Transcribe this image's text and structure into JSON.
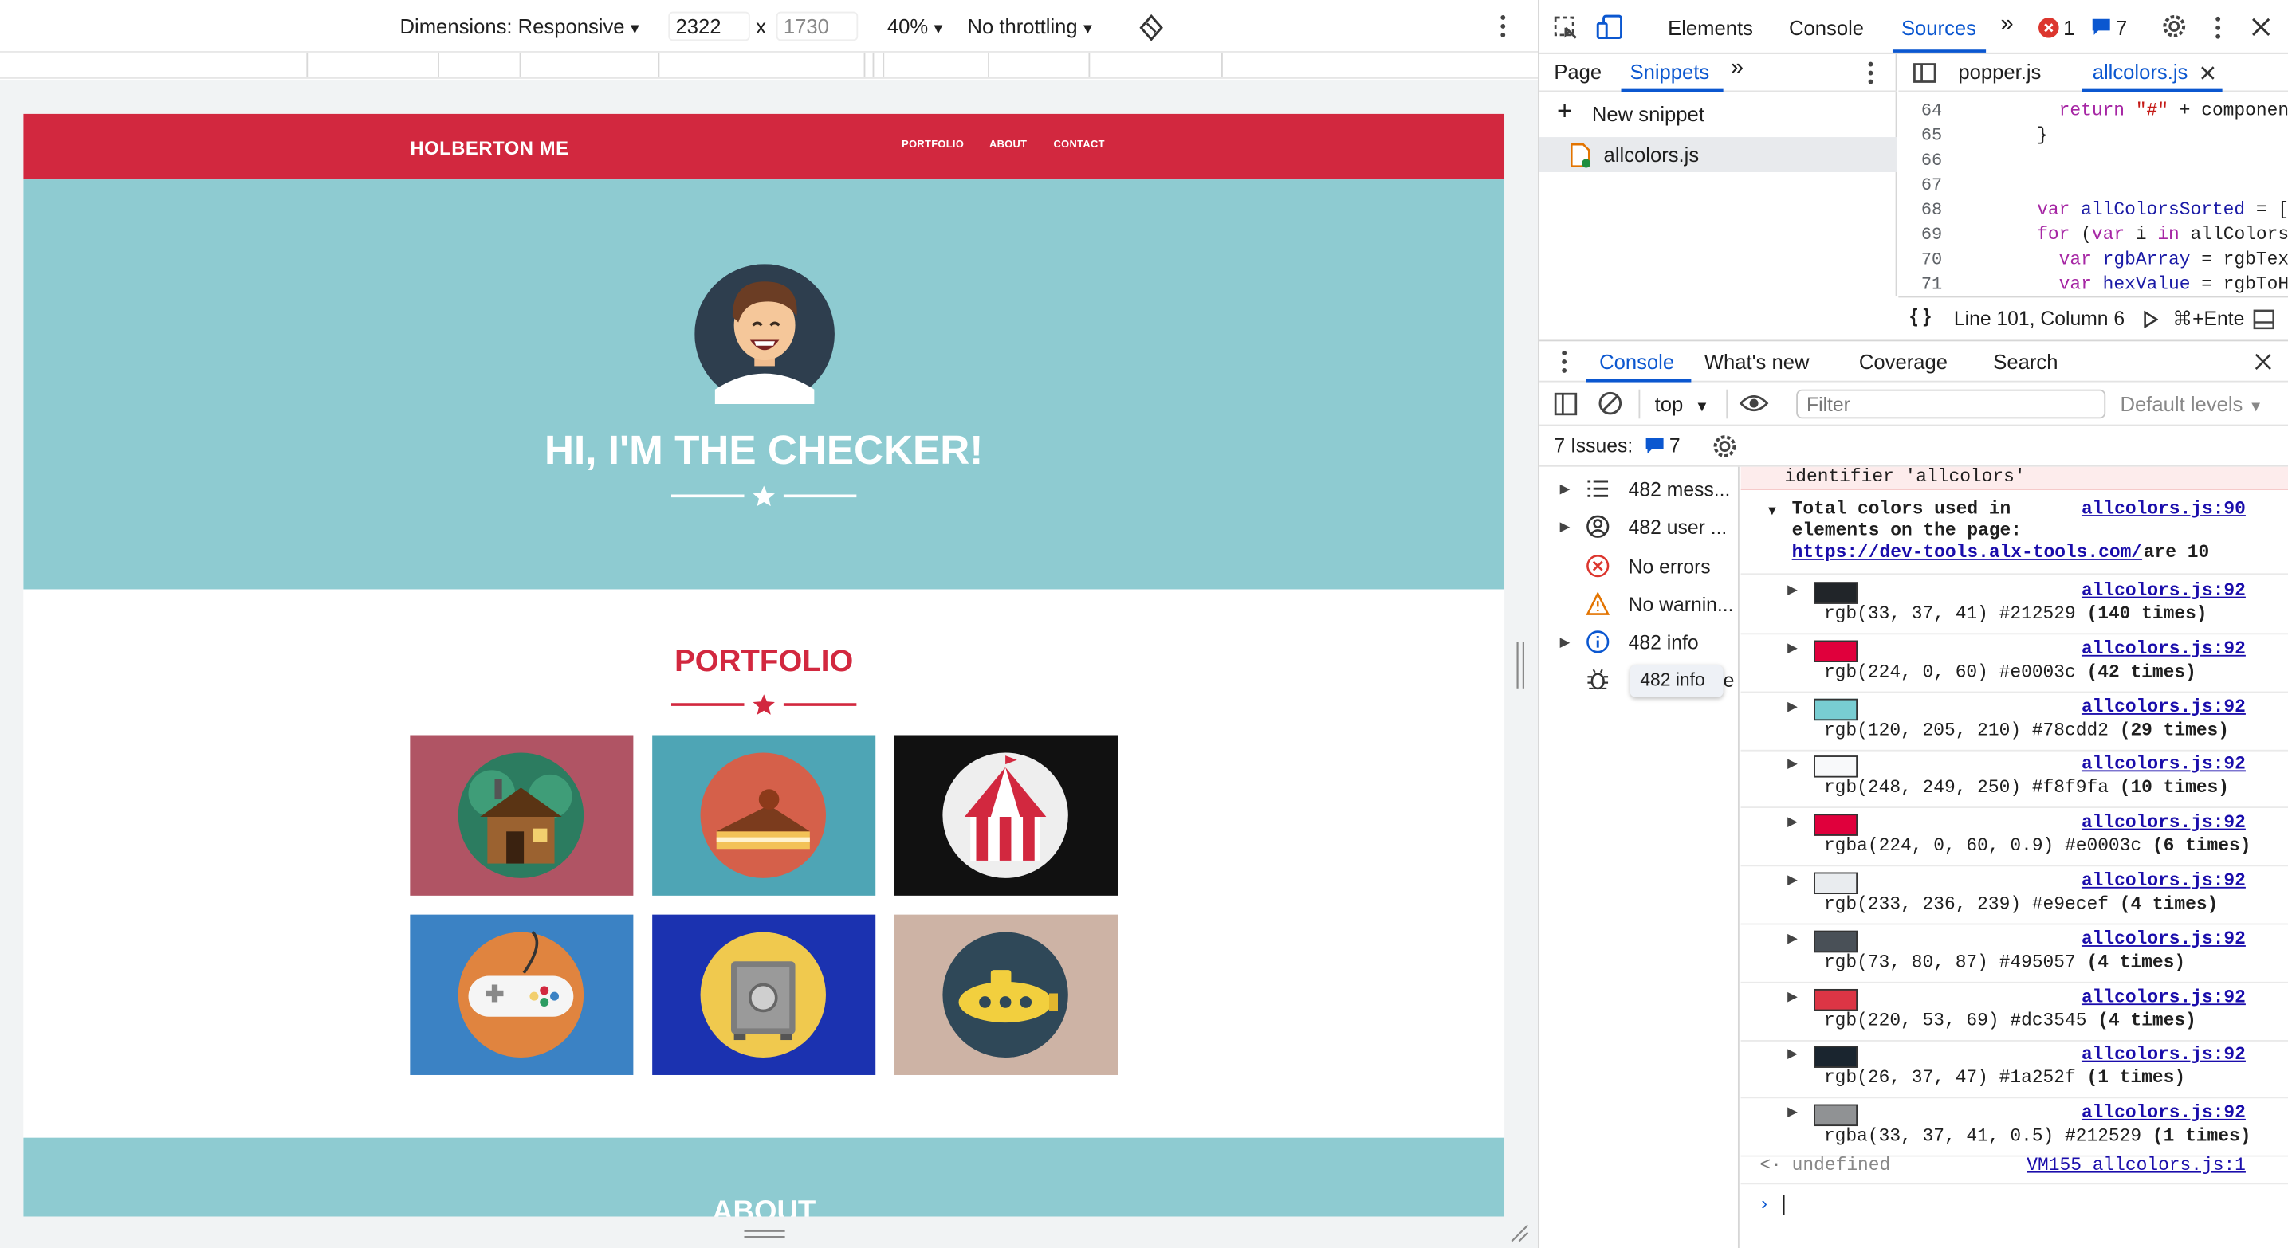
{
  "device_toolbar": {
    "dimensions_label": "Dimensions: Responsive",
    "width": "2322",
    "height": "1730",
    "times": "x",
    "zoom": "40%",
    "throttling": "No throttling"
  },
  "site": {
    "brand": "HOLBERTON ME",
    "nav": [
      "PORTFOLIO",
      "ABOUT",
      "CONTACT"
    ],
    "hero_title": "HI, I'M THE CHECKER!",
    "portfolio_title": "PORTFOLIO",
    "about_title": "ABOUT",
    "tiles": [
      {
        "name": "cabin",
        "bg": "#b05464"
      },
      {
        "name": "cake",
        "bg": "#4ea5b5"
      },
      {
        "name": "circus",
        "bg": "#111111"
      },
      {
        "name": "controller",
        "bg": "#3b82c4"
      },
      {
        "name": "safe",
        "bg": "#1b32b0"
      },
      {
        "name": "submarine",
        "bg": "#cdb3a5"
      }
    ],
    "colors": {
      "red": "#d2283f",
      "teal": "#8ecbd1"
    }
  },
  "devtools": {
    "tabs": [
      "Elements",
      "Console",
      "Sources"
    ],
    "active_tab": "Sources",
    "error_count": "1",
    "issue_count": "7",
    "navigator": {
      "tabs": [
        "Page",
        "Snippets"
      ],
      "active": "Snippets",
      "new_snippet": "New snippet",
      "file": "allcolors.js"
    },
    "editor": {
      "open_files": [
        "popper.js",
        "allcolors.js"
      ],
      "lines": [
        {
          "n": "64",
          "code": "    return \"#\" + componentTo"
        },
        {
          "n": "65",
          "code": "  }"
        },
        {
          "n": "66",
          "code": ""
        },
        {
          "n": "67",
          "code": ""
        },
        {
          "n": "68",
          "code": "  var allColorsSorted = [];"
        },
        {
          "n": "69",
          "code": "  for (var i in allColors) {"
        },
        {
          "n": "70",
          "code": "    var rgbArray = rgbTextTo"
        },
        {
          "n": "71",
          "code": "    var hexValue = rgbToHex("
        }
      ],
      "status": "Line 101, Column 6",
      "run_hint": "⌘+Ente"
    },
    "drawer_tabs": [
      "Console",
      "What's new",
      "Coverage",
      "Search"
    ],
    "drawer_active": "Console",
    "console_toolbar": {
      "context": "top",
      "filter_placeholder": "Filter",
      "levels": "Default levels"
    },
    "issues_label": "7 Issues:",
    "issues_count": "7",
    "sidebar": [
      {
        "label": "482 mess...",
        "icon": "list-icon"
      },
      {
        "label": "482 user ...",
        "icon": "user-icon"
      },
      {
        "label": "No errors",
        "icon": "error-icon"
      },
      {
        "label": "No warnin...",
        "icon": "warning-icon"
      },
      {
        "label": "482 info",
        "icon": "info-icon"
      },
      {
        "label": "",
        "icon": "bug-icon"
      }
    ],
    "tooltip": "482 info",
    "tooltip_tail": "e",
    "console": {
      "error_tail": "identifier 'allcolors'",
      "group_title_1": "Total colors used in",
      "group_title_2": "elements on the page:",
      "group_link": "https://dev-tools.alx-tools.com/",
      "group_tail": "are 10",
      "group_source": "allcolors.js:90",
      "rows": [
        {
          "swatch": "#212529",
          "value": "rgb(33, 37, 41) #212529",
          "count": "(140 times)",
          "source": "allcolors.js:92"
        },
        {
          "swatch": "#e0003c",
          "value": "rgb(224, 0, 60) #e0003c",
          "count": "(42 times)",
          "source": "allcolors.js:92"
        },
        {
          "swatch": "#78cdd2",
          "value": "rgb(120, 205, 210) #78cdd2",
          "count": "(29 times)",
          "source": "allcolors.js:92"
        },
        {
          "swatch": "#f8f9fa",
          "value": "rgb(248, 249, 250) #f8f9fa",
          "count": "(10 times)",
          "source": "allcolors.js:92"
        },
        {
          "swatch": "#e0003c",
          "value": "rgba(224, 0, 60, 0.9) #e0003c",
          "count": "(6 times)",
          "source": "allcolors.js:92"
        },
        {
          "swatch": "#e9ecef",
          "value": "rgb(233, 236, 239) #e9ecef",
          "count": "(4 times)",
          "source": "allcolors.js:92"
        },
        {
          "swatch": "#495057",
          "value": "rgb(73, 80, 87) #495057",
          "count": "(4 times)",
          "source": "allcolors.js:92"
        },
        {
          "swatch": "#dc3545",
          "value": "rgb(220, 53, 69) #dc3545",
          "count": "(4 times)",
          "source": "allcolors.js:92"
        },
        {
          "swatch": "#1a252f",
          "value": "rgb(26, 37, 47) #1a252f",
          "count": "(1 times)",
          "source": "allcolors.js:92"
        },
        {
          "swatch": "#909294",
          "value": "rgba(33, 37, 41, 0.5) #212529",
          "count": "(1 times)",
          "source": "allcolors.js:92"
        }
      ],
      "result": "undefined",
      "result_source": "VM155 allcolors.js:1"
    }
  }
}
